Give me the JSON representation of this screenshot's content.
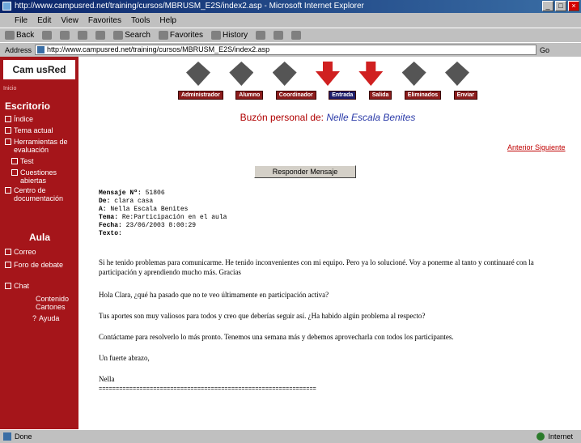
{
  "window": {
    "title": "http://www.campusred.net/training/cursos/MBRUSM_E2S/index2.asp - Microsoft Internet Explorer"
  },
  "menubar": [
    "File",
    "Edit",
    "View",
    "Favorites",
    "Tools",
    "Help"
  ],
  "toolbar": {
    "back": "Back",
    "search": "Search",
    "favorites": "Favorites",
    "history": "History"
  },
  "address": {
    "label": "Address",
    "url": "http://www.campusred.net/training/cursos/MBRUSM_E2S/index2.asp",
    "go": "Go"
  },
  "sidebar": {
    "logo": "Cam usRed",
    "small": "Inicio",
    "section1": "Escritorio",
    "items1": [
      "Índice",
      "Tema actual",
      "Herramientas de evaluación",
      "Test",
      "Cuestiones abiertas",
      "Centro de documentación"
    ],
    "section2": "Aula",
    "items2": [
      "Correo",
      "Foro de debate",
      "Chat",
      "Contenido Cartones",
      "Ayuda"
    ]
  },
  "banner": {
    "tabs": [
      "Administrador",
      "Alumno",
      "Coordinador",
      "Entrada",
      "Salida",
      "Eliminados",
      "Enviar"
    ],
    "active_tab": "Entrada",
    "buzon_label": "Buzón personal de:",
    "buzon_name": "Nelle Escala Benites"
  },
  "paging": "Anterior Siguiente",
  "reply_button": "Responder Mensaje",
  "message": {
    "numero_label": "Mensaje Nº:",
    "numero": "51806",
    "de_label": "De:",
    "de": "clara casa",
    "a_label": "A:",
    "a": "Nella Escala Benites",
    "tema_label": "Tema:",
    "tema": "Re:Participación en el aula",
    "fecha_label": "Fecha:",
    "fecha": "23/06/2003 8:00:29",
    "texto_label": "Texto:",
    "body": [
      "Si he tenido problemas para comunicarme. He tenido inconvenientes con mi equipo. Pero ya lo solucioné. Voy a ponerme al tanto y continuaré con la participación y aprendiendo mucho más. Gracias",
      "Hola Clara, ¿qué ha pasado que no te veo últimamente en participación activa?",
      "Tus aportes son muy valiosos para todos y creo que deberías seguir así. ¿Ha habido algún problema al respecto?",
      "Contáctame para resolverlo lo más pronto. Tenemos una semana más y debemos aprovecharla con todos los participantes.",
      "Un fuerte abrazo,",
      "Nella",
      "================================================================"
    ]
  },
  "status": {
    "left": "Done",
    "zone": "Internet"
  }
}
